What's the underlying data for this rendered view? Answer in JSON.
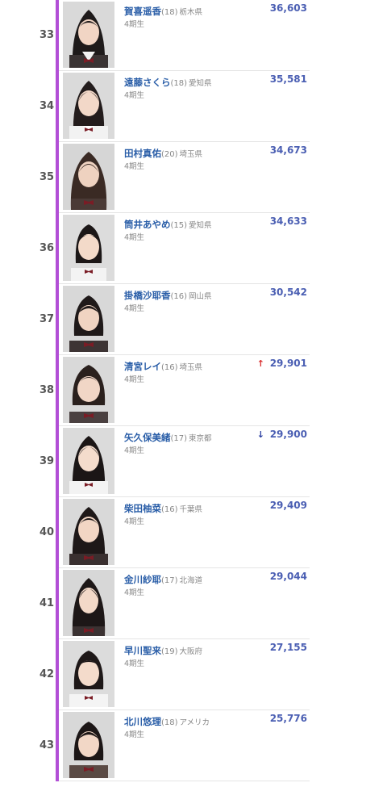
{
  "colors": {
    "accent_bar": "#b24fd6",
    "name": "#2a5ea8",
    "votes": "#4b5fb3",
    "up": "#d93030",
    "down": "#2a3ea0"
  },
  "rows": [
    {
      "rank": "33",
      "name": "賀喜遥香",
      "age": "(18)",
      "pref": "栃木県",
      "gen": "4期生",
      "votes": "36,603",
      "trend": ""
    },
    {
      "rank": "34",
      "name": "遠藤さくら",
      "age": "(18)",
      "pref": "愛知県",
      "gen": "4期生",
      "votes": "35,581",
      "trend": ""
    },
    {
      "rank": "35",
      "name": "田村真佑",
      "age": "(20)",
      "pref": "埼玉県",
      "gen": "4期生",
      "votes": "34,673",
      "trend": ""
    },
    {
      "rank": "36",
      "name": "筒井あやめ",
      "age": "(15)",
      "pref": "愛知県",
      "gen": "4期生",
      "votes": "34,633",
      "trend": ""
    },
    {
      "rank": "37",
      "name": "掛橋沙耶香",
      "age": "(16)",
      "pref": "岡山県",
      "gen": "4期生",
      "votes": "30,542",
      "trend": ""
    },
    {
      "rank": "38",
      "name": "清宮レイ",
      "age": "(16)",
      "pref": "埼玉県",
      "gen": "4期生",
      "votes": "29,901",
      "trend": "up-arrow"
    },
    {
      "rank": "39",
      "name": "矢久保美緒",
      "age": "(17)",
      "pref": "東京都",
      "gen": "4期生",
      "votes": "29,900",
      "trend": "down-arrow"
    },
    {
      "rank": "40",
      "name": "柴田柚菜",
      "age": "(16)",
      "pref": "千葉県",
      "gen": "4期生",
      "votes": "29,409",
      "trend": ""
    },
    {
      "rank": "41",
      "name": "金川紗耶",
      "age": "(17)",
      "pref": "北海道",
      "gen": "4期生",
      "votes": "29,044",
      "trend": ""
    },
    {
      "rank": "42",
      "name": "早川聖来",
      "age": "(19)",
      "pref": "大阪府",
      "gen": "4期生",
      "votes": "27,155",
      "trend": ""
    },
    {
      "rank": "43",
      "name": "北川悠理",
      "age": "(18)",
      "pref": "アメリカ",
      "gen": "4期生",
      "votes": "25,776",
      "trend": ""
    }
  ]
}
